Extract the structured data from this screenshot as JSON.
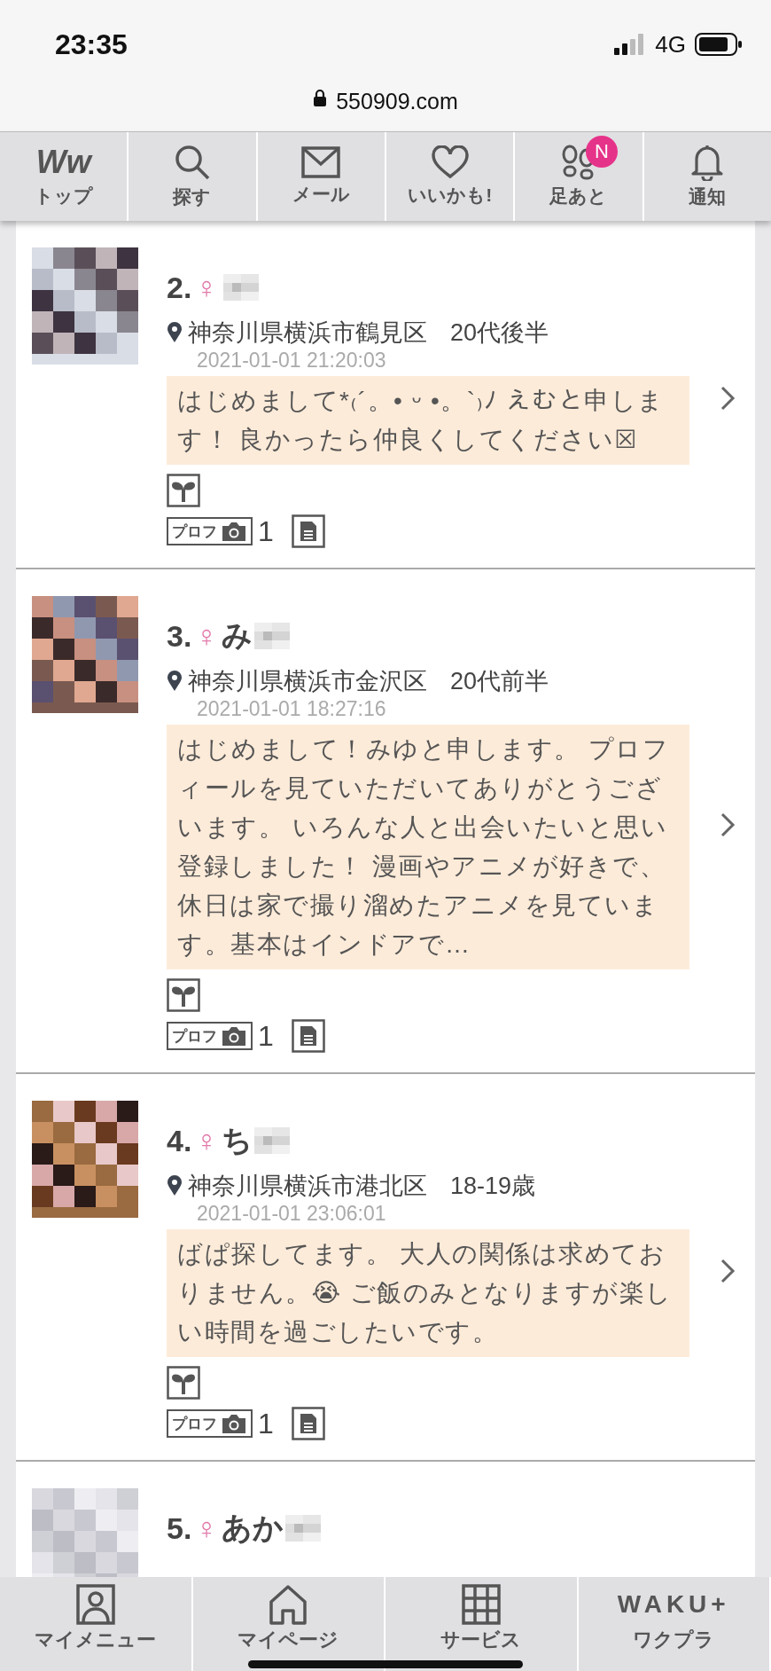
{
  "status_bar": {
    "time": "23:35",
    "network": "4G"
  },
  "address_bar": {
    "url": "550909.com"
  },
  "top_nav": [
    {
      "label": "トップ",
      "kind": "logo",
      "logo_text": "Ww"
    },
    {
      "label": "探す",
      "kind": "search"
    },
    {
      "label": "メール",
      "kind": "mail"
    },
    {
      "label": "いいかも!",
      "kind": "heart"
    },
    {
      "label": "足あと",
      "kind": "footprints",
      "badge": "N"
    },
    {
      "label": "通知",
      "kind": "bell"
    }
  ],
  "profiles": [
    {
      "number": "2.",
      "gender": "♀",
      "location": "神奈川県横浜市鶴見区",
      "age": "20代後半",
      "date": "2021-01-01 21:20:03",
      "message": "はじめまして*₍´。• ᵕ •。`₎ﾉ えむと申します！ 良かったら仲良くしてください☒",
      "photo_badge": "プロフ",
      "photo_count": "1"
    },
    {
      "number": "3.",
      "gender": "♀",
      "name": "み",
      "location": "神奈川県横浜市金沢区",
      "age": "20代前半",
      "date": "2021-01-01 18:27:16",
      "message": "はじめまして！みゆと申します。 プロフィールを見ていただいてありがとうございます。 いろんな人と出会いたいと思い登録しました！ 漫画やアニメが好きで、休日は家で撮り溜めたアニメを見ています。基本はインドアで…",
      "photo_badge": "プロフ",
      "photo_count": "1"
    },
    {
      "number": "4.",
      "gender": "♀",
      "name": "ち",
      "location": "神奈川県横浜市港北区",
      "age": "18-19歳",
      "date": "2021-01-01 23:06:01",
      "message": "ばぱ探してます。 大人の関係は求めておりません。😭 ご飯のみとなりますが楽しい時間を過ごしたいです。",
      "photo_badge": "プロフ",
      "photo_count": "1"
    },
    {
      "number": "5.",
      "gender": "♀",
      "name": "あか"
    }
  ],
  "bottom_nav": [
    {
      "label": "マイメニュー",
      "kind": "person"
    },
    {
      "label": "マイページ",
      "kind": "home"
    },
    {
      "label": "サービス",
      "kind": "grid"
    },
    {
      "label": "ワクプラ",
      "kind": "logo",
      "logo_text": "WAKU+"
    }
  ]
}
